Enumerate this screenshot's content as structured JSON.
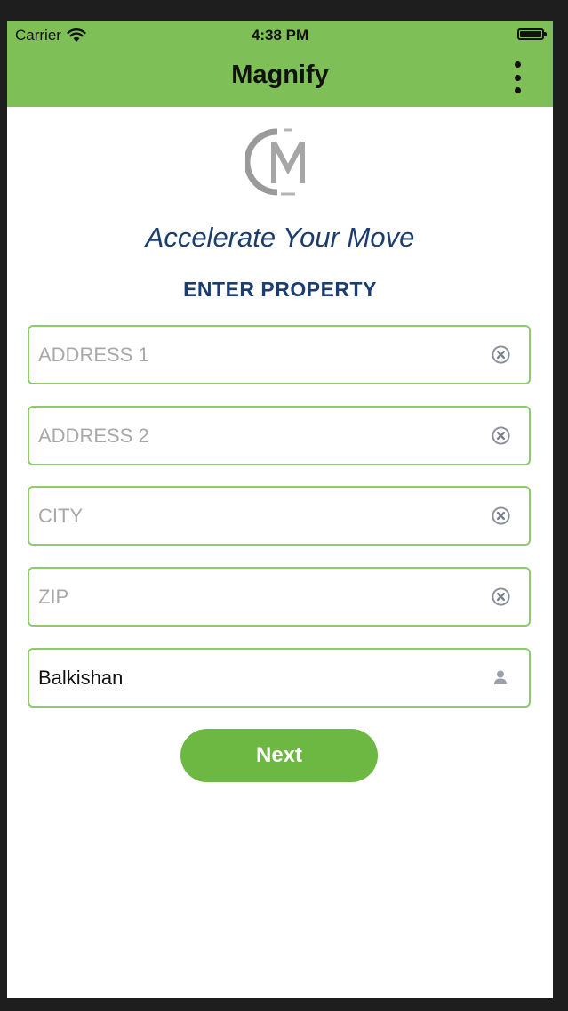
{
  "status_bar": {
    "carrier": "Carrier",
    "time": "4:38 PM",
    "battery_level": 1.0
  },
  "app_bar": {
    "title": "Magnify",
    "menu_icon": "more-vertical-icon"
  },
  "header": {
    "tagline": "Accelerate Your Move",
    "section_title": "ENTER PROPERTY"
  },
  "form": {
    "address1": {
      "value": "",
      "placeholder": "ADDRESS 1",
      "icon": "clear-icon"
    },
    "address2": {
      "value": "",
      "placeholder": "ADDRESS 2",
      "icon": "clear-icon"
    },
    "city": {
      "value": "",
      "placeholder": "CITY",
      "icon": "clear-icon"
    },
    "zip": {
      "value": "",
      "placeholder": "ZIP",
      "icon": "clear-icon"
    },
    "name": {
      "value": "Balkishan",
      "placeholder": "",
      "icon": "user-icon"
    }
  },
  "actions": {
    "next_label": "Next"
  },
  "colors": {
    "bar": "#7fbf57",
    "accent_button": "#6db842",
    "field_border": "#8ccc6a",
    "heading": "#1b3d70",
    "placeholder": "#a8a8a8"
  }
}
